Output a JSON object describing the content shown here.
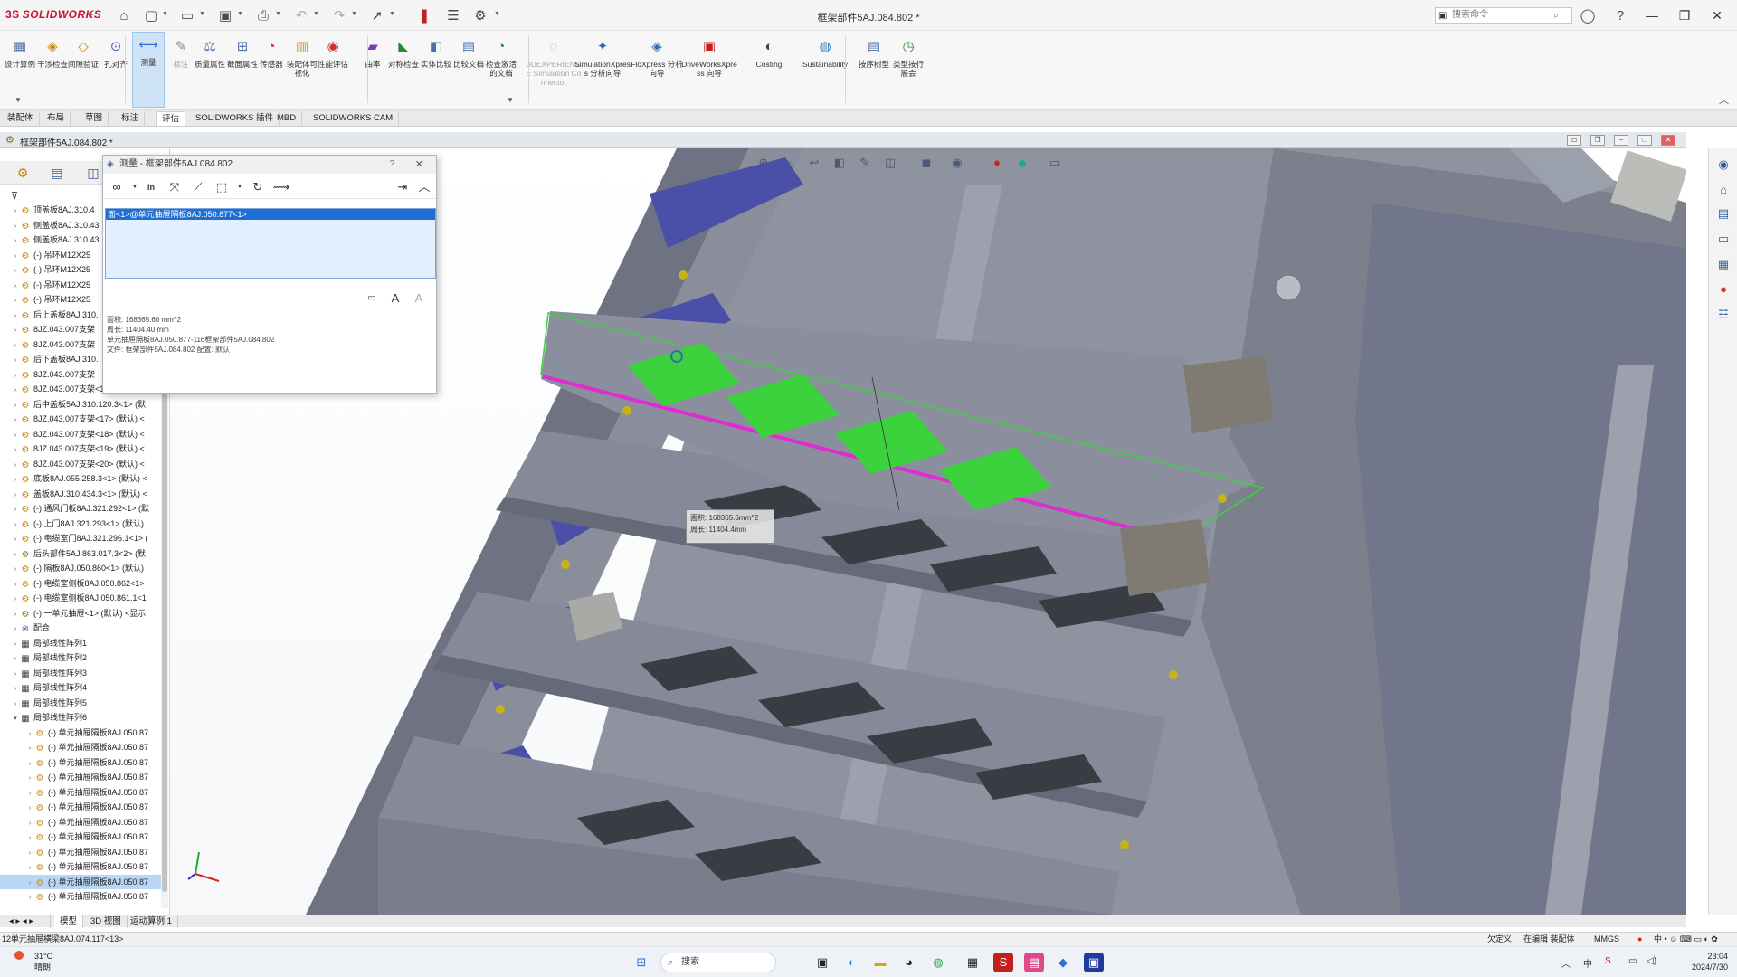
{
  "app": {
    "logo_ds": "3S",
    "logo_name": "SOLIDWORKS",
    "document_title": "框架部件5AJ.084.802 *",
    "search_placeholder": "搜索命令"
  },
  "ribbon": {
    "buttons": [
      {
        "label": "设计算例",
        "icon": "design-study-icon"
      },
      {
        "label": "干涉检查",
        "icon": "interference-icon"
      },
      {
        "label": "间隙验证",
        "icon": "clearance-icon"
      },
      {
        "label": "孔对齐",
        "icon": "hole-align-icon"
      },
      {
        "label": "测量",
        "icon": "measure-icon"
      },
      {
        "label": "标注",
        "icon": "markup-icon"
      },
      {
        "label": "质量属性",
        "icon": "mass-properties-icon"
      },
      {
        "label": "截面属性",
        "icon": "section-properties-icon"
      },
      {
        "label": "传感器",
        "icon": "sensor-icon"
      },
      {
        "label": "装配体可视化",
        "icon": "assembly-visualization-icon"
      },
      {
        "label": "性能评估",
        "icon": "performance-icon"
      },
      {
        "label": "曲率",
        "icon": "curvature-icon"
      },
      {
        "label": "对称检查",
        "icon": "symmetry-icon"
      },
      {
        "label": "实体比较",
        "icon": "body-compare-icon"
      },
      {
        "label": "比较文档",
        "icon": "compare-docs-icon"
      },
      {
        "label": "检查激活的文档",
        "icon": "check-doc-icon"
      },
      {
        "label": "3DEXPERIENCE Simulation Connector",
        "icon": "3dx-icon"
      },
      {
        "label": "SimulationXpress 分析向导",
        "icon": "simxpress-icon"
      },
      {
        "label": "FloXpress 分析向导",
        "icon": "floxpress-icon"
      },
      {
        "label": "DriveWorksXpress 向导",
        "icon": "driveworks-icon"
      },
      {
        "label": "Costing",
        "icon": "costing-icon"
      },
      {
        "label": "Sustainability",
        "icon": "sustainability-icon"
      },
      {
        "label": "按序树型",
        "icon": "tree-order-icon"
      },
      {
        "label": "类型按行展会",
        "icon": "history-icon"
      }
    ]
  },
  "cm_tabs": [
    "装配体",
    "布局",
    "草图",
    "标注",
    "评估",
    "SOLIDWORKS 插件",
    "MBD",
    "SOLIDWORKS CAM"
  ],
  "document_window": {
    "title": "框架部件5AJ.084.802 *"
  },
  "tree": {
    "items": [
      {
        "label": "顶盖板8AJ.310.4",
        "icon": "part"
      },
      {
        "label": "侧盖板8AJ.310.43",
        "icon": "part"
      },
      {
        "label": "侧盖板8AJ.310.43",
        "icon": "part"
      },
      {
        "label": "(-) 吊环M12X25",
        "icon": "part"
      },
      {
        "label": "(-) 吊环M12X25",
        "icon": "part"
      },
      {
        "label": "(-) 吊环M12X25",
        "icon": "part"
      },
      {
        "label": "(-) 吊环M12X25",
        "icon": "part"
      },
      {
        "label": "后上盖板8AJ.310.",
        "icon": "part"
      },
      {
        "label": "8JZ.043.007支架",
        "icon": "part"
      },
      {
        "label": "8JZ.043.007支架",
        "icon": "part"
      },
      {
        "label": "后下盖板8AJ.310.",
        "icon": "part"
      },
      {
        "label": "8JZ.043.007支架",
        "icon": "part"
      },
      {
        "label": "8JZ.043.007支架<16> (默认) <",
        "icon": "part"
      },
      {
        "label": "后中盖板5AJ.310.120.3<1> (默",
        "icon": "part"
      },
      {
        "label": "8JZ.043.007支架<17> (默认) <",
        "icon": "part"
      },
      {
        "label": "8JZ.043.007支架<18> (默认) <",
        "icon": "part"
      },
      {
        "label": "8JZ.043.007支架<19> (默认) <",
        "icon": "part"
      },
      {
        "label": "8JZ.043.007支架<20> (默认) <",
        "icon": "part"
      },
      {
        "label": "底板8AJ.055.258.3<1> (默认) <",
        "icon": "part"
      },
      {
        "label": "盖板8AJ.310.434.3<1> (默认) <",
        "icon": "part"
      },
      {
        "label": "(-) 通风门板8AJ.321.292<1> (默",
        "icon": "part"
      },
      {
        "label": "(-) 上门8AJ.321.293<1> (默认)",
        "icon": "part"
      },
      {
        "label": "(-) 电缆室门8AJ.321.296.1<1> (",
        "icon": "part"
      },
      {
        "label": "后头部件5AJ.863.017.3<2> (默",
        "icon": "asm"
      },
      {
        "label": "(-) 隔板8AJ.050.860<1> (默认)",
        "icon": "part"
      },
      {
        "label": "(-) 电缆室侧板8AJ.050.862<1>",
        "icon": "part"
      },
      {
        "label": "(-) 电缆室侧板8AJ.050.861.1<1",
        "icon": "part"
      },
      {
        "label": "(-) 一单元抽屉<1> (默认) <显示",
        "icon": "asm"
      },
      {
        "label": "配合",
        "icon": "mate"
      },
      {
        "label": "局部线性阵列1",
        "icon": "pat"
      },
      {
        "label": "局部线性阵列2",
        "icon": "pat"
      },
      {
        "label": "局部线性阵列3",
        "icon": "pat"
      },
      {
        "label": "局部线性阵列4",
        "icon": "pat"
      },
      {
        "label": "局部线性阵列5",
        "icon": "pat"
      },
      {
        "label": "局部线性阵列6",
        "icon": "pat"
      },
      {
        "label": "(-) 单元抽屉隔板8AJ.050.87",
        "icon": "part"
      },
      {
        "label": "(-) 单元抽屉隔板8AJ.050.87",
        "icon": "part"
      },
      {
        "label": "(-) 单元抽屉隔板8AJ.050.87",
        "icon": "part"
      },
      {
        "label": "(-) 单元抽屉隔板8AJ.050.87",
        "icon": "part"
      },
      {
        "label": "(-) 单元抽屉隔板8AJ.050.87",
        "icon": "part"
      },
      {
        "label": "(-) 单元抽屉隔板8AJ.050.87",
        "icon": "part"
      },
      {
        "label": "(-) 单元抽屉隔板8AJ.050.87",
        "icon": "part"
      },
      {
        "label": "(-) 单元抽屉隔板8AJ.050.87",
        "icon": "part"
      },
      {
        "label": "(-) 单元抽屉隔板8AJ.050.87",
        "icon": "part"
      },
      {
        "label": "(-) 单元抽屉隔板8AJ.050.87",
        "icon": "part"
      },
      {
        "label": "(-) 单元抽屉隔板8AJ.050.87",
        "icon": "part"
      },
      {
        "label": "(-) 单元抽屉隔板8AJ.050.87",
        "icon": "part"
      }
    ]
  },
  "measure": {
    "title": "测量 - 框架部件5AJ.084.802",
    "selection": "面<1>@单元抽屉隔板8AJ.050.877<1>",
    "results": [
      "面积:  168365.60 mm^2",
      "周长:  11404.40 mm",
      "单元抽屉隔板8AJ.050.877-116框架部件5AJ.084.802",
      "文件:  框架部件5AJ.084.802  配置:  默认"
    ]
  },
  "callout": {
    "line1": "面积: 168365.6mm^2",
    "line2": "周长: 11404.4mm"
  },
  "bottom_tabs": [
    "模型",
    "3D 视图",
    "运动算例 1"
  ],
  "status": {
    "left": "12单元抽屉横梁8AJ.074.117<13>",
    "items": [
      "欠定义",
      "在编辑 装配体",
      "MMGS"
    ]
  },
  "taskbar": {
    "weather_temp": "31°C",
    "weather_desc": "晴朗",
    "search_label": "搜索",
    "time": "23:04",
    "date": "2024/7/30"
  },
  "colors": {
    "accent_blue": "#1f6ed4",
    "highlight_green": "#3bd23d",
    "edge_magenta": "#e02ad3",
    "steel_gray": "#7e8290",
    "bracket_blue": "#4a4fa8"
  }
}
